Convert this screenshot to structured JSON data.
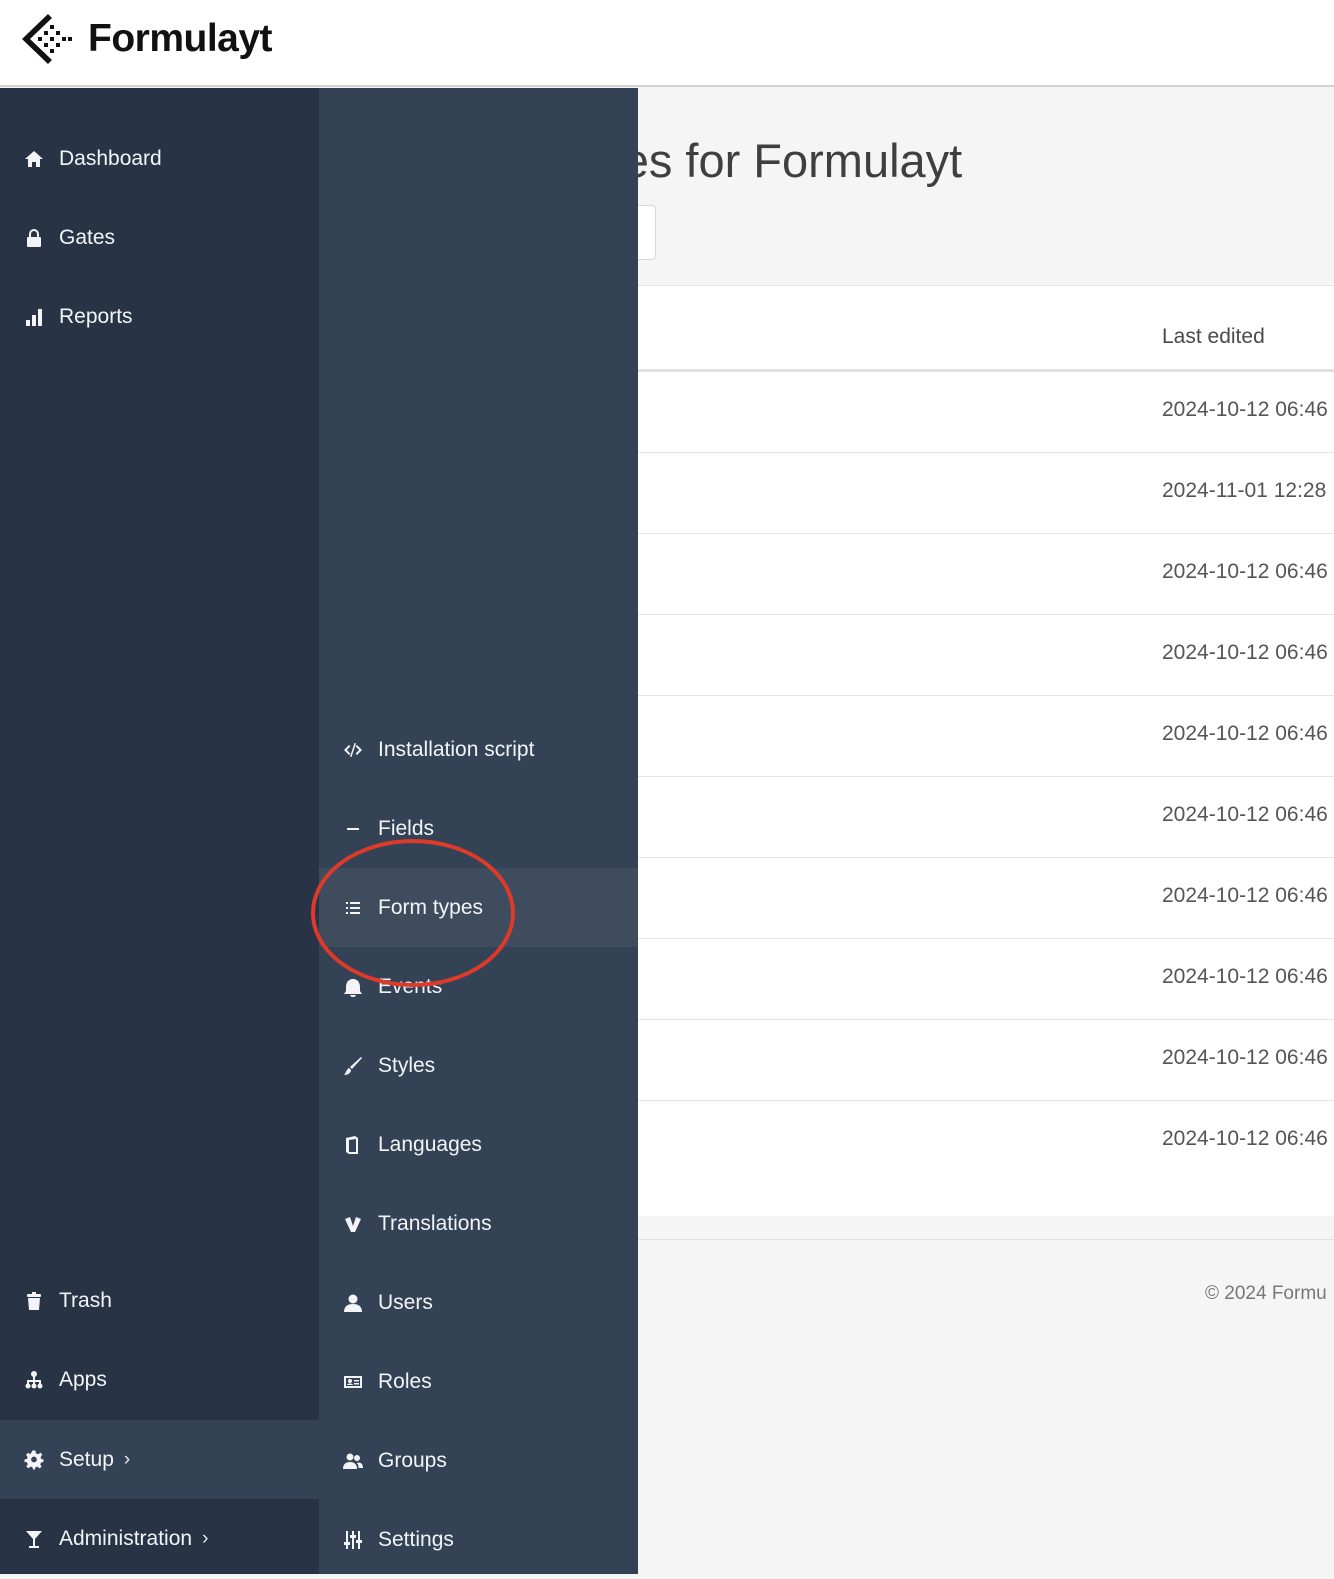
{
  "app": {
    "brand": "Formulayt"
  },
  "page": {
    "title_visible": "types for Formulayt",
    "table": {
      "last_edited_header": "Last edited",
      "rows": [
        "2024-10-12 06:46",
        "2024-11-01 12:28",
        "2024-10-12 06:46",
        "2024-10-12 06:46",
        "2024-10-12 06:46",
        "2024-10-12 06:46",
        "2024-10-12 06:46",
        "2024-10-12 06:46",
        "2024-10-12 06:46",
        "2024-10-12 06:46"
      ]
    },
    "footer": "© 2024 Formu"
  },
  "sidebar": {
    "items": [
      {
        "label": "Dashboard",
        "icon": "home-icon"
      },
      {
        "label": "Gates",
        "icon": "lock-icon"
      },
      {
        "label": "Reports",
        "icon": "bar-chart-icon"
      },
      {
        "label": "Trash",
        "icon": "trash-icon"
      },
      {
        "label": "Apps",
        "icon": "sitemap-icon"
      },
      {
        "label": "Setup",
        "icon": "gear-icon",
        "active": true,
        "chevron": "›"
      },
      {
        "label": "Administration",
        "icon": "cocktail-icon",
        "chevron": "›"
      }
    ]
  },
  "submenu": {
    "items": [
      {
        "label": "Installation script",
        "icon": "code-icon"
      },
      {
        "label": "Fields",
        "icon": "minus-icon"
      },
      {
        "label": "Form types",
        "icon": "list-icon",
        "active": true
      },
      {
        "label": "Events",
        "icon": "bell-icon"
      },
      {
        "label": "Styles",
        "icon": "brush-icon"
      },
      {
        "label": "Languages",
        "icon": "book-icon"
      },
      {
        "label": "Translations",
        "icon": "translate-icon"
      },
      {
        "label": "Users",
        "icon": "user-icon"
      },
      {
        "label": "Roles",
        "icon": "id-card-icon"
      },
      {
        "label": "Groups",
        "icon": "users-icon"
      },
      {
        "label": "Settings",
        "icon": "sliders-icon"
      }
    ]
  },
  "colors": {
    "sidebar_bg": "#283446",
    "submenu_bg": "#334254",
    "active_bg": "#3e4c5e",
    "annotation": "#dd3a2a"
  }
}
